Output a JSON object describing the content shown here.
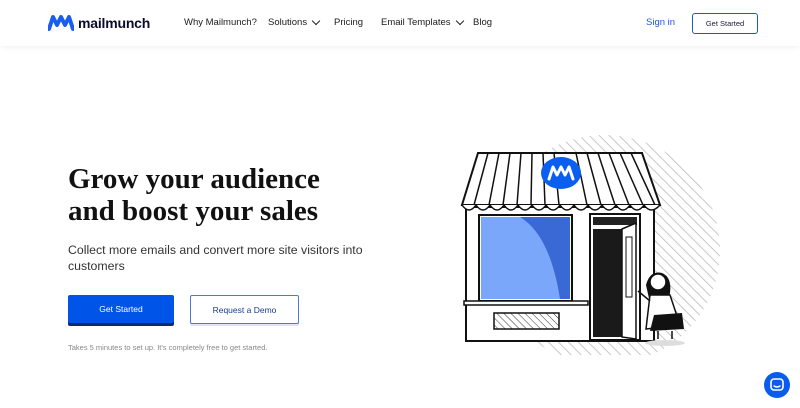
{
  "header": {
    "logo_text": "mailmunch",
    "nav": [
      {
        "label": "Why Mailmunch?",
        "dropdown": false
      },
      {
        "label": "Solutions",
        "dropdown": true
      },
      {
        "label": "Pricing",
        "dropdown": false
      },
      {
        "label": "Email Templates",
        "dropdown": true
      },
      {
        "label": "Blog",
        "dropdown": false
      }
    ],
    "signin_label": "Sign in",
    "cta_label": "Get Started"
  },
  "hero": {
    "headline": "Grow your audience and boost your sales",
    "subtext": "Collect more emails and convert more site visitors into customers",
    "primary_button": "Get Started",
    "secondary_button": "Request a Demo",
    "note": "Takes 5 minutes to set up. It's completely free to get started."
  },
  "colors": {
    "brand_blue": "#0055e8",
    "link_blue": "#1a56db",
    "window_blue": "#7aa7fa"
  },
  "icons": {
    "logo": "mailmunch-logo-icon",
    "chat": "chat-bubble-icon"
  }
}
